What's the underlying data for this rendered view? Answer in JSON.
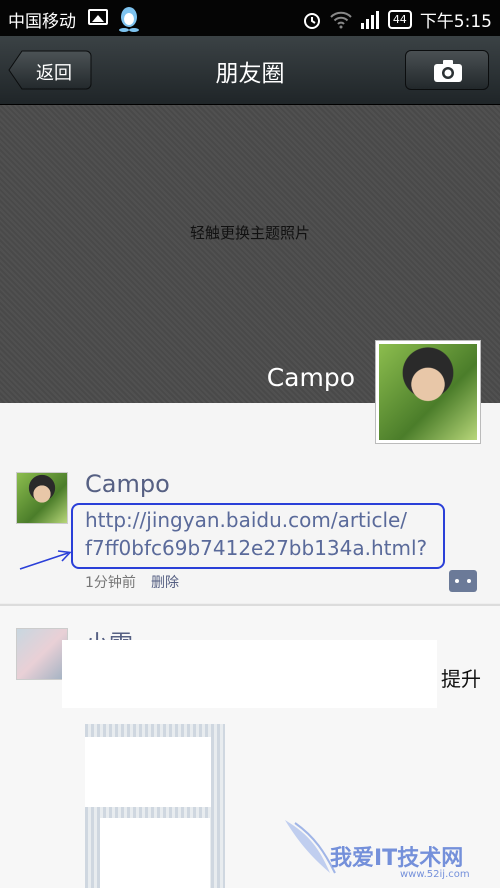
{
  "status_bar": {
    "carrier": "中国移动",
    "battery": "44",
    "time": "下午5:15"
  },
  "nav": {
    "back_label": "返回",
    "title": "朋友圈"
  },
  "cover": {
    "hint": "轻触更换主题照片",
    "name": "Campo"
  },
  "posts": [
    {
      "author": "Campo",
      "link_line1": "http://jingyan.baidu.com/article/",
      "link_line2": "f7ff0bfc69b7412e27bb134a.html?",
      "time": "1分钟前",
      "delete_label": "删除"
    },
    {
      "author": "小雪",
      "text_tail": "提升"
    }
  ],
  "watermark": {
    "text": "我爱IT技术网",
    "url": "www.52ij.com"
  }
}
